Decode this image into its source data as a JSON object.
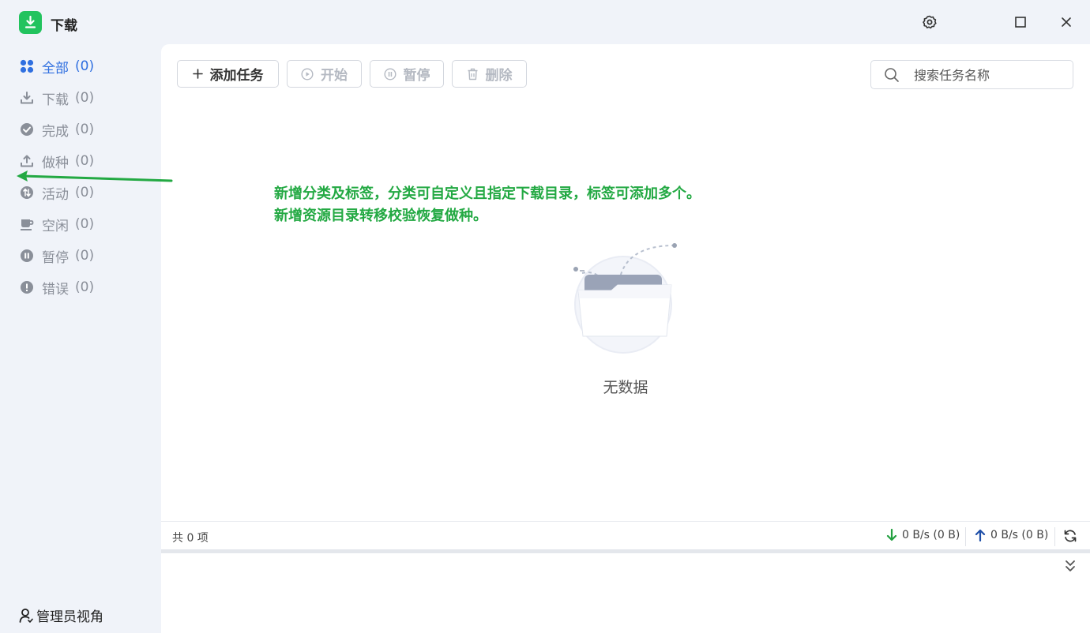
{
  "app": {
    "title": "下载"
  },
  "sidebar": {
    "items": [
      {
        "label": "全部",
        "count": "(0)",
        "icon": "grid-icon",
        "active": true
      },
      {
        "label": "下载",
        "count": "(0)",
        "icon": "download-icon"
      },
      {
        "label": "完成",
        "count": "(0)",
        "icon": "check-circle-icon"
      },
      {
        "label": "做种",
        "count": "(0)",
        "icon": "upload-icon"
      },
      {
        "label": "活动",
        "count": "(0)",
        "icon": "activity-icon"
      },
      {
        "label": "空闲",
        "count": "(0)",
        "icon": "coffee-icon"
      },
      {
        "label": "暂停",
        "count": "(0)",
        "icon": "pause-circle-icon"
      },
      {
        "label": "错误",
        "count": "(0)",
        "icon": "alert-circle-icon"
      }
    ],
    "admin_label": "管理员视角"
  },
  "toolbar": {
    "add_label": "添加任务",
    "start_label": "开始",
    "pause_label": "暂停",
    "delete_label": "删除"
  },
  "search": {
    "placeholder": "搜索任务名称",
    "value": ""
  },
  "annotation": {
    "line1": "新增分类及标签，分类可自定义且指定下载目录，标签可添加多个。",
    "line2": "新增资源目录转移校验恢复做种。",
    "color": "#23a943"
  },
  "empty": {
    "text": "无数据"
  },
  "status": {
    "total": "共 0 项",
    "download_speed": "0 B/s (0 B)",
    "upload_speed": "0 B/s (0 B)"
  },
  "colors": {
    "accent": "#2f6fe0",
    "brand": "#22c35e",
    "download": "#22a040",
    "upload": "#1f4fa8"
  }
}
